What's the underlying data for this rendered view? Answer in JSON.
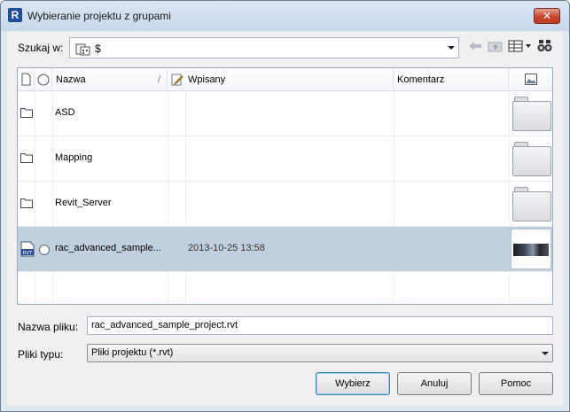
{
  "window": {
    "title": "Wybieranie projektu z grupami",
    "app_icon_letter": "R",
    "close_glyph": "✕"
  },
  "lookin": {
    "label": "Szukaj w:",
    "value": "$"
  },
  "columns": {
    "name": "Nazwa",
    "sort_glyph": "/",
    "checked_in": "Wpisany",
    "comment": "Komentarz"
  },
  "rows": [
    {
      "name": "ASD",
      "date": "",
      "type": "folder"
    },
    {
      "name": "Mapping",
      "date": "",
      "type": "folder"
    },
    {
      "name": "Revit_Server",
      "date": "",
      "type": "folder"
    },
    {
      "name": "rac_advanced_sample...",
      "date": "2013-10-25 13:58",
      "type": "rvt",
      "selected": true,
      "badge": "RVT"
    }
  ],
  "filename": {
    "label": "Nazwa pliku:",
    "value": "rac_advanced_sample_project.rvt"
  },
  "filetype": {
    "label": "Pliki typu:",
    "value": "Pliki projektu (*.rvt)"
  },
  "buttons": {
    "choose": "Wybierz",
    "cancel": "Anuluj",
    "help": "Pomoc"
  },
  "icons": [
    "app-icon",
    "close-icon",
    "folder-group-icon",
    "back-icon",
    "up-folder-icon",
    "views-icon",
    "search-icon",
    "document-icon",
    "radio-icon",
    "edit-icon",
    "preview-icon",
    "folder-icon",
    "rvt-file-icon"
  ],
  "colors": {
    "selection": "#c1d0df",
    "title_bar": "#c9d8ec",
    "close_button": "#c7452f"
  }
}
